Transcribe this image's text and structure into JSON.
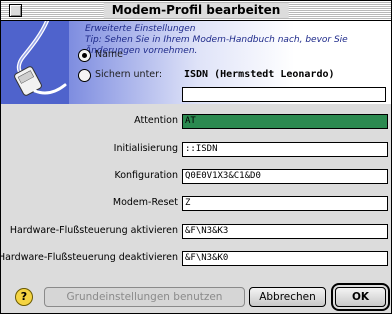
{
  "window": {
    "title": "Modem-Profil bearbeiten"
  },
  "info": {
    "heading": "Erweiterte Einstellungen",
    "line1": "Tip: Sehen Sie in Ihrem Modem-Handbuch nach, bevor Sie",
    "line2": "Änderungen vornehmen."
  },
  "profile": {
    "name_label": "Name",
    "name_value": "ISDN (Hermstedt Leonardo)",
    "save_label": "Sichern unter:",
    "save_value": ""
  },
  "fields": [
    {
      "label": "Attention",
      "value": "AT"
    },
    {
      "label": "Initialisierung",
      "value": "::ISDN"
    },
    {
      "label": "Konfiguration",
      "value": "Q0E0V1X3&C1&D0"
    },
    {
      "label": "Modem-Reset",
      "value": "Z"
    },
    {
      "label": "Hardware-Flußsteuerung aktivieren",
      "value": "&F\\N3&K3"
    },
    {
      "label": "Hardware-Flußsteuerung deaktivieren",
      "value": "&F\\N3&K0"
    }
  ],
  "buttons": {
    "defaults": "Grundeinstellungen benutzen",
    "cancel": "Abbrechen",
    "ok": "OK"
  },
  "icons": {
    "help": "?"
  },
  "colors": {
    "banner": "#4f63cc",
    "selected_field": "#2b8a50"
  }
}
